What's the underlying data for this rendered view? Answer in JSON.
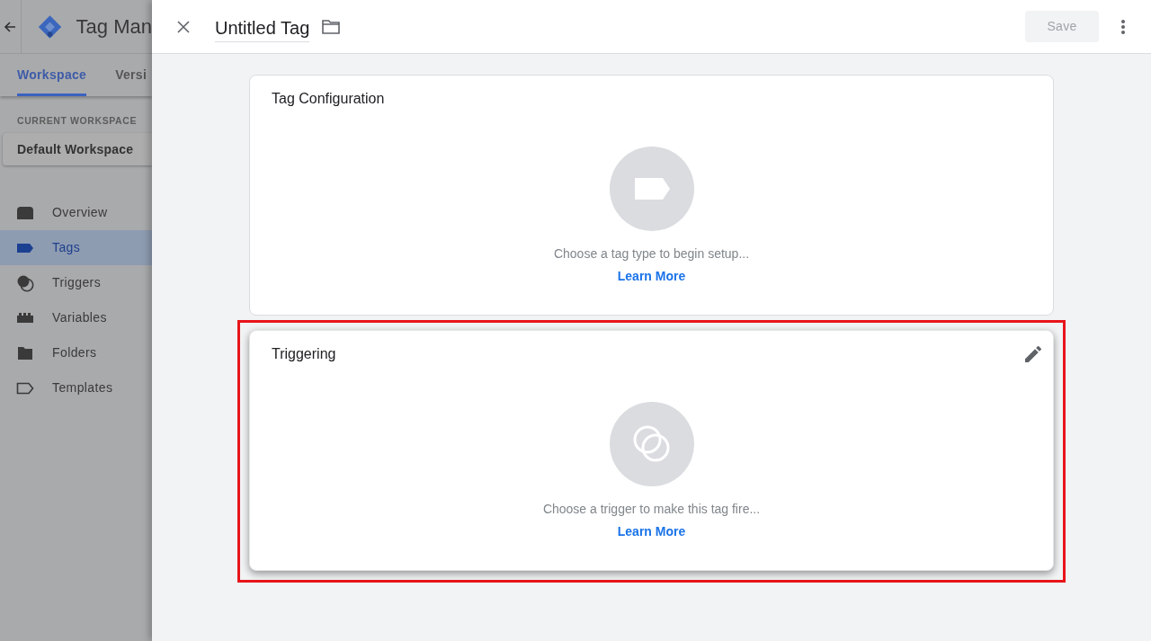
{
  "app": {
    "title": "Tag Man",
    "tabs": [
      {
        "label": "Workspace",
        "selected": true
      },
      {
        "label": "Versi",
        "selected": false
      }
    ],
    "workspace_label": "CURRENT WORKSPACE",
    "workspace": "Default Workspace",
    "nav": [
      {
        "label": "Overview",
        "kind": "overview",
        "selected": false
      },
      {
        "label": "Tags",
        "kind": "tags",
        "selected": true
      },
      {
        "label": "Triggers",
        "kind": "triggers",
        "selected": false
      },
      {
        "label": "Variables",
        "kind": "variables",
        "selected": false
      },
      {
        "label": "Folders",
        "kind": "folders",
        "selected": false
      },
      {
        "label": "Templates",
        "kind": "templates",
        "selected": false
      }
    ]
  },
  "panel": {
    "title": "Untitled Tag",
    "save": {
      "label": "Save",
      "disabled": true
    }
  },
  "cards": [
    {
      "kind": "tag",
      "title": "Tag Configuration",
      "description": "Choose a tag type to begin setup...",
      "link": "Learn More",
      "hovered": false,
      "highlighted": false
    },
    {
      "kind": "trigger",
      "title": "Triggering",
      "description": "Choose a trigger to make this tag fire...",
      "link": "Learn More",
      "hovered": true,
      "highlighted": true
    }
  ]
}
